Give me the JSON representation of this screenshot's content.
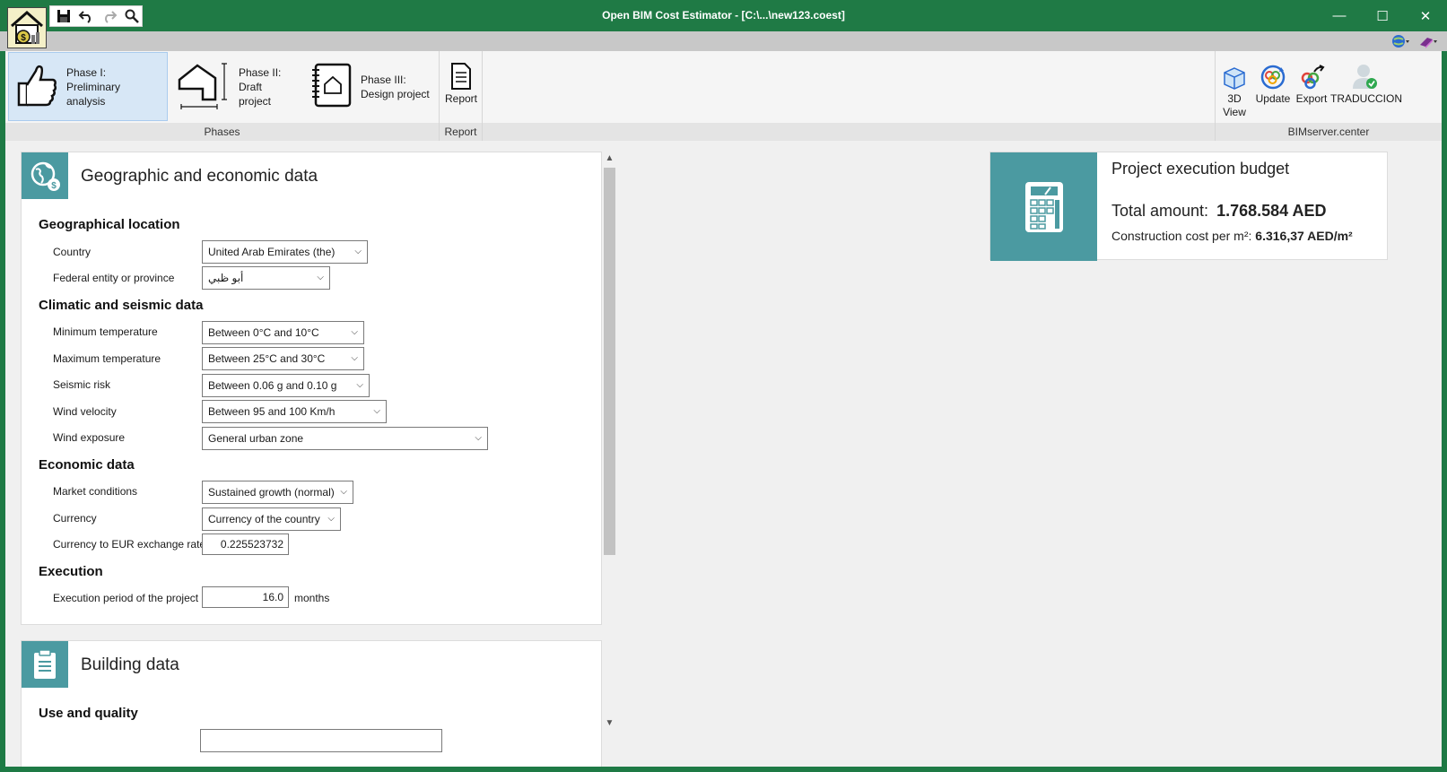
{
  "window": {
    "title": "Open BIM Cost Estimator - [C:\\...\\new123.coest]",
    "minimize": "—",
    "maximize": "☐",
    "close": "✕"
  },
  "ribbon": {
    "phase1": {
      "line1": "Phase I:",
      "line2": "Preliminary analysis"
    },
    "phase2": {
      "line1": "Phase II:",
      "line2": "Draft project"
    },
    "phase3": {
      "line1": "Phase III:",
      "line2": "Design project"
    },
    "phases_group": "Phases",
    "report": "Report",
    "report_group": "Report",
    "view3d_line1": "3D",
    "view3d_line2": "View",
    "update": "Update",
    "export": "Export",
    "traduccion": "TRADUCCION",
    "bim_group": "BIMserver.center"
  },
  "geo": {
    "title": "Geographic and economic data",
    "loc_section": "Geographical location",
    "country_label": "Country",
    "country_value": "United Arab Emirates (the)",
    "province_label": "Federal entity or province",
    "province_value": "أبو ظبي",
    "climate_section": "Climatic and seismic data",
    "min_temp_label": "Minimum temperature",
    "min_temp_value": "Between 0°C and 10°C",
    "max_temp_label": "Maximum temperature",
    "max_temp_value": "Between 25°C and 30°C",
    "seismic_label": "Seismic risk",
    "seismic_value": "Between 0.06 g and 0.10 g",
    "wind_vel_label": "Wind velocity",
    "wind_vel_value": "Between 95 and 100 Km/h",
    "wind_exp_label": "Wind exposure",
    "wind_exp_value": "General urban zone",
    "econ_section": "Economic data",
    "market_label": "Market conditions",
    "market_value": "Sustained growth (normal)",
    "currency_label": "Currency",
    "currency_value": "Currency of the country",
    "rate_label": "Currency to EUR exchange rate",
    "rate_value": "0.225523732",
    "exec_section": "Execution",
    "period_label": "Execution period of the project",
    "period_value": "16.0",
    "period_unit": "months"
  },
  "building": {
    "title": "Building data",
    "use_section": "Use and quality"
  },
  "budget": {
    "title": "Project execution budget",
    "total_label": "Total amount:",
    "total_value": "1.768.584 AED",
    "cpm_label": "Construction cost per m²:",
    "cpm_value": "6.316,37 AED/m²"
  },
  "colors": {
    "titlebar": "#1f7a45",
    "accent": "#4b9aa1",
    "ribbon_active": "#d7e7f6"
  }
}
